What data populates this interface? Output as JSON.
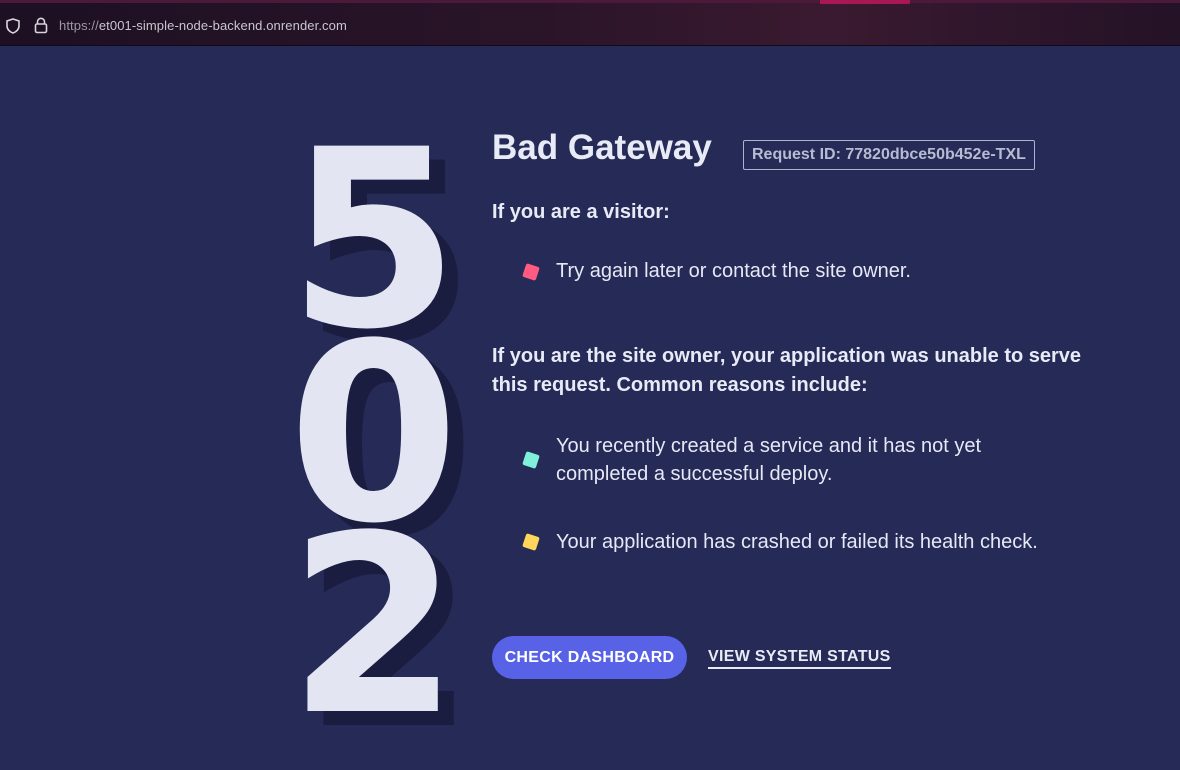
{
  "browser": {
    "url_protocol": "https://",
    "url_host": "et001-simple-node-backend.onrender.com"
  },
  "error_code_digits": [
    "5",
    "0",
    "2"
  ],
  "title": "Bad Gateway",
  "request_id": "Request ID: 77820dbce50b452e-TXL",
  "visitor": {
    "heading": "If you are a visitor:",
    "items": [
      "Try again later or contact the site owner."
    ]
  },
  "owner": {
    "heading": "If you are the site owner, your application was unable to serve this request. Common reasons include:",
    "items": [
      "You recently created a service and it has not yet completed a successful deploy.",
      "Your application has crashed or failed its health check."
    ]
  },
  "actions": {
    "primary_label": "CHECK DASHBOARD",
    "secondary_label": "VIEW SYSTEM STATUS"
  },
  "colors": {
    "background": "#252a57",
    "primary_button": "#5762e6",
    "bullet_pink": "#ff5b82",
    "bullet_teal": "#7ff0d9",
    "bullet_yellow": "#ffd659"
  }
}
